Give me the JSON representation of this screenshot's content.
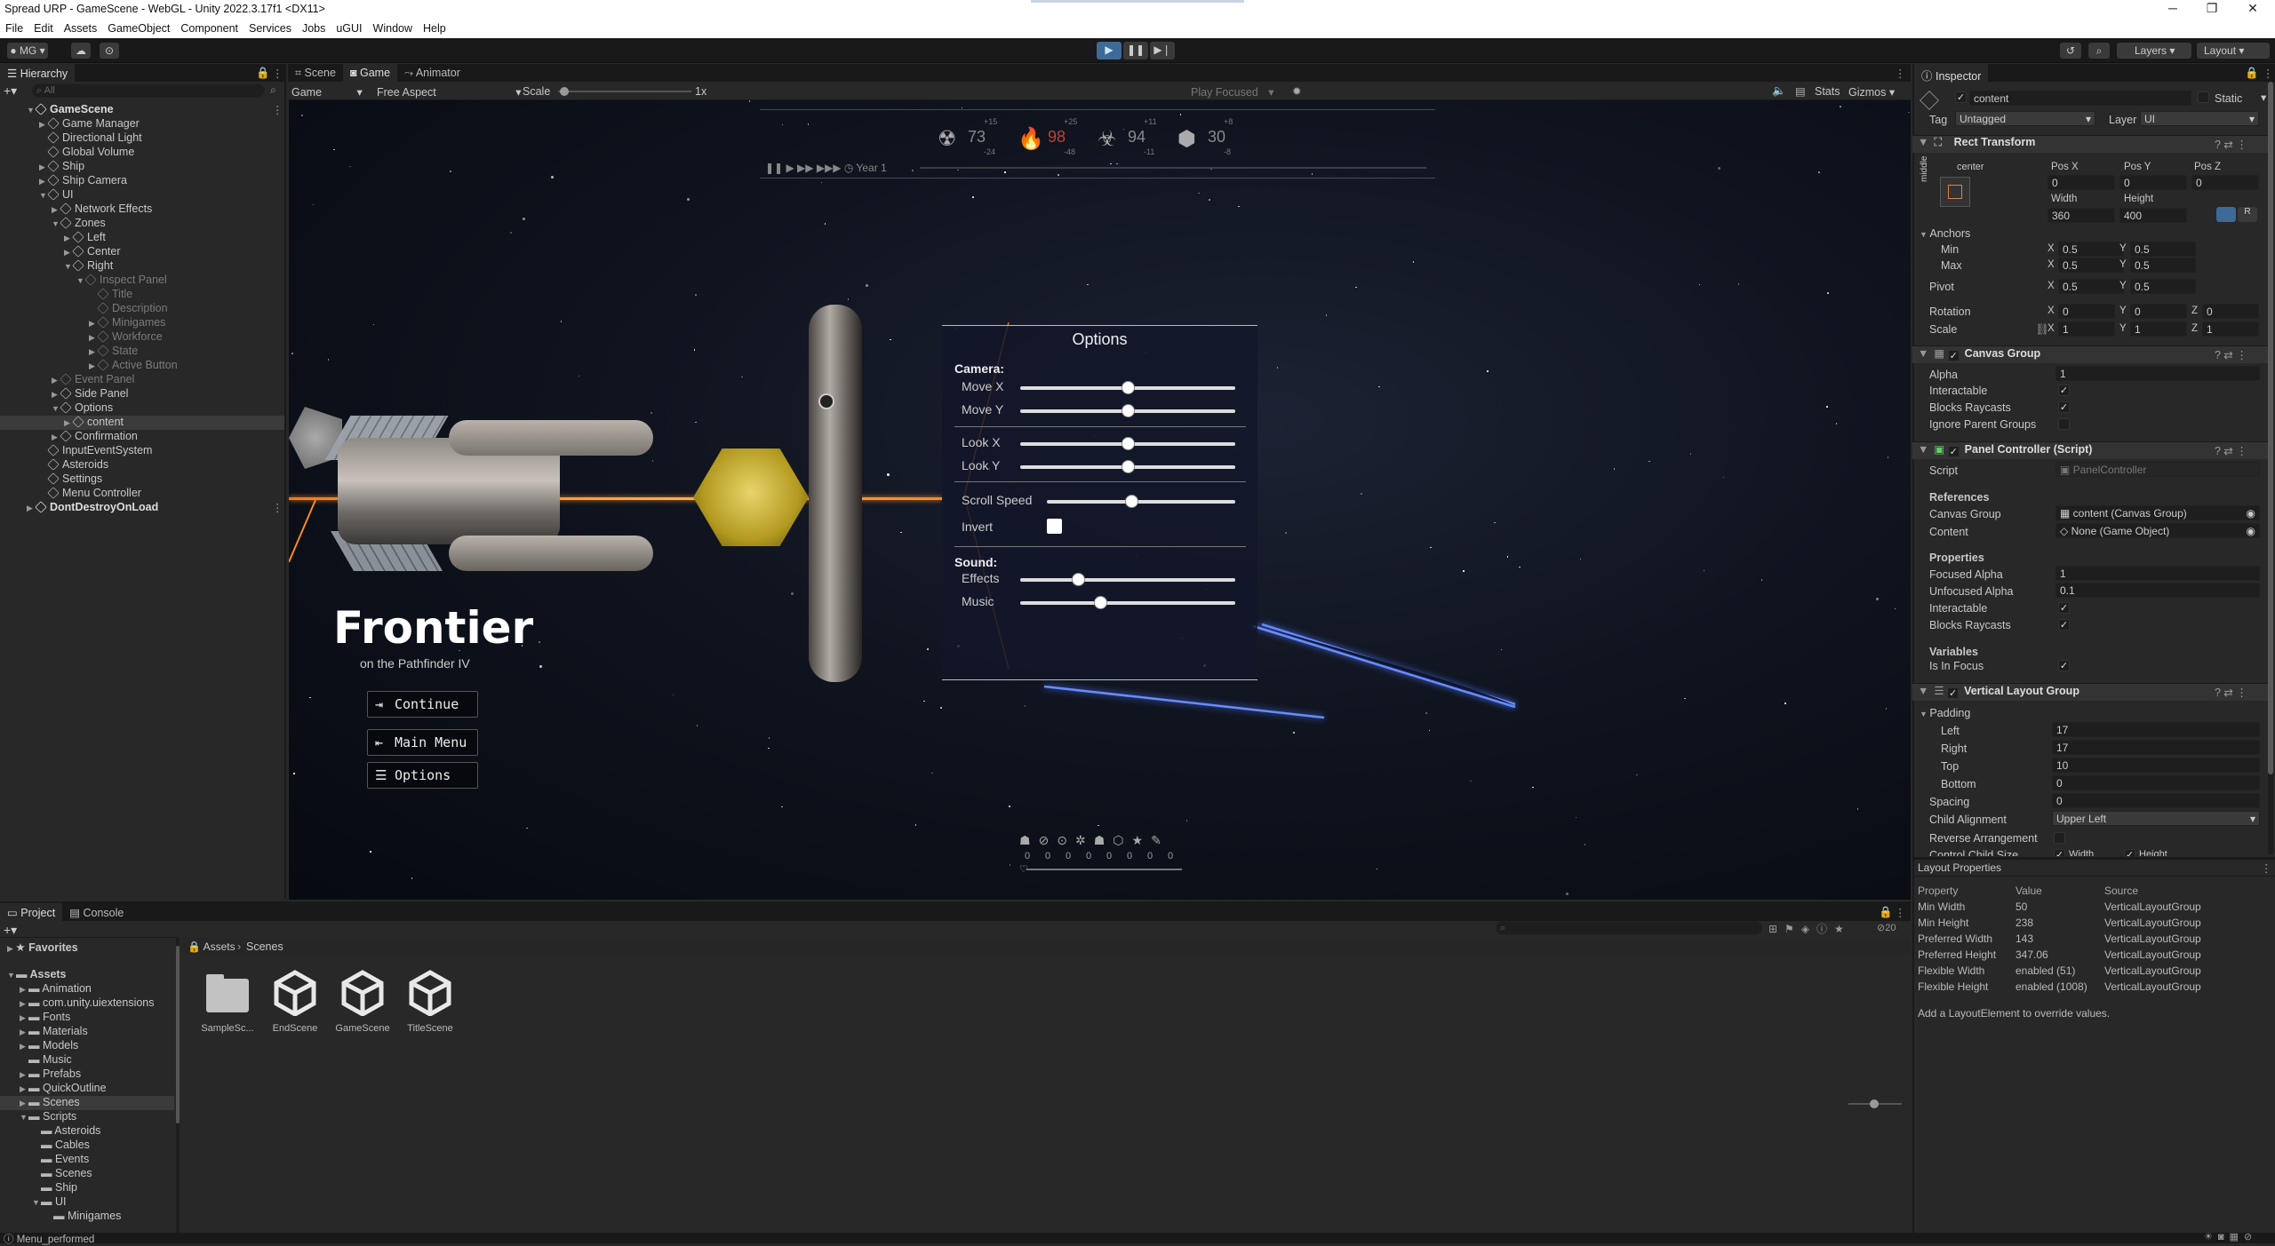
{
  "window": {
    "title": "Spread URP - GameScene - WebGL - Unity 2022.3.17f1 <DX11>",
    "controls": [
      "─",
      "❐",
      "✕"
    ]
  },
  "menu": [
    "File",
    "Edit",
    "Assets",
    "GameObject",
    "Component",
    "Services",
    "Jobs",
    "uGUI",
    "Window",
    "Help"
  ],
  "toolbar": {
    "account": "MG",
    "layers": "Layers",
    "layout": "Layout"
  },
  "hierarchy": {
    "tab": "Hierarchy",
    "search_placeholder": "All",
    "items": [
      {
        "label": "GameScene",
        "depth": 0,
        "arrow": "▼",
        "dim": false
      },
      {
        "label": "Game Manager",
        "depth": 1,
        "arrow": "▶",
        "dim": false
      },
      {
        "label": "Directional Light",
        "depth": 1,
        "arrow": "",
        "dim": false
      },
      {
        "label": "Global Volume",
        "depth": 1,
        "arrow": "",
        "dim": false
      },
      {
        "label": "Ship",
        "depth": 1,
        "arrow": "▶",
        "dim": false
      },
      {
        "label": "Ship Camera",
        "depth": 1,
        "arrow": "▶",
        "dim": false
      },
      {
        "label": "UI",
        "depth": 1,
        "arrow": "▼",
        "dim": false
      },
      {
        "label": "Network Effects",
        "depth": 2,
        "arrow": "▶",
        "dim": false
      },
      {
        "label": "Zones",
        "depth": 2,
        "arrow": "▼",
        "dim": false
      },
      {
        "label": "Left",
        "depth": 3,
        "arrow": "▶",
        "dim": false
      },
      {
        "label": "Center",
        "depth": 3,
        "arrow": "▶",
        "dim": false
      },
      {
        "label": "Right",
        "depth": 3,
        "arrow": "▼",
        "dim": false
      },
      {
        "label": "Inspect Panel",
        "depth": 4,
        "arrow": "▼",
        "dim": true
      },
      {
        "label": "Title",
        "depth": 5,
        "arrow": "",
        "dim": true
      },
      {
        "label": "Description",
        "depth": 5,
        "arrow": "",
        "dim": true
      },
      {
        "label": "Minigames",
        "depth": 5,
        "arrow": "▶",
        "dim": true
      },
      {
        "label": "Workforce",
        "depth": 5,
        "arrow": "▶",
        "dim": true
      },
      {
        "label": "State",
        "depth": 5,
        "arrow": "▶",
        "dim": true
      },
      {
        "label": "Active Button",
        "depth": 5,
        "arrow": "▶",
        "dim": true
      },
      {
        "label": "Event Panel",
        "depth": 2,
        "arrow": "▶",
        "dim": true
      },
      {
        "label": "Side Panel",
        "depth": 2,
        "arrow": "▶",
        "dim": false
      },
      {
        "label": "Options",
        "depth": 2,
        "arrow": "▼",
        "dim": false
      },
      {
        "label": "content",
        "depth": 3,
        "arrow": "▶",
        "dim": false,
        "selected": true
      },
      {
        "label": "Confirmation",
        "depth": 2,
        "arrow": "▶",
        "dim": false
      },
      {
        "label": "InputEventSystem",
        "depth": 1,
        "arrow": "",
        "dim": false
      },
      {
        "label": "Asteroids",
        "depth": 1,
        "arrow": "",
        "dim": false
      },
      {
        "label": "Settings",
        "depth": 1,
        "arrow": "",
        "dim": false
      },
      {
        "label": "Menu Controller",
        "depth": 1,
        "arrow": "",
        "dim": false
      },
      {
        "label": "DontDestroyOnLoad",
        "depth": 0,
        "arrow": "▶",
        "dim": false
      }
    ]
  },
  "center_tabs": [
    "Scene",
    "Game",
    "Animator"
  ],
  "game_bar": {
    "display": "Game",
    "aspect": "Free Aspect",
    "scale_label": "Scale",
    "scale_value": "1x",
    "play_focused": "Play Focused",
    "stats": "Stats",
    "gizmos": "Gizmos"
  },
  "hud": {
    "counters": [
      "73",
      "98",
      "94",
      "30"
    ],
    "deltas_top": [
      "+15",
      "+25",
      "+11",
      "+8"
    ],
    "deltas_bottom": [
      "-24",
      "-48",
      "-11",
      "-8"
    ],
    "timer_label": "Year 1"
  },
  "game_ui": {
    "title": "Frontier",
    "subtitle": "on the Pathfinder IV",
    "buttons": [
      "Continue",
      "Main Menu",
      "Options"
    ]
  },
  "options_panel": {
    "title": "Options",
    "camera_heading": "Camera:",
    "sound_heading": "Sound:",
    "sliders": [
      {
        "label": "Move X",
        "value": 0.5
      },
      {
        "label": "Move Y",
        "value": 0.5
      },
      {
        "label": "Look X",
        "value": 0.5
      },
      {
        "label": "Look Y",
        "value": 0.5
      },
      {
        "label": "Scroll Speed",
        "value": 0.45
      },
      {
        "label": "Effects",
        "value": 0.27
      },
      {
        "label": "Music",
        "value": 0.37
      }
    ],
    "invert_label": "Invert"
  },
  "bottom_hud": {
    "values": [
      "0",
      "0",
      "0",
      "0",
      "0",
      "0",
      "0",
      "0"
    ]
  },
  "inspector": {
    "tab": "Inspector",
    "object_name": "content",
    "static_label": "Static",
    "tag_label": "Tag",
    "tag_value": "Untagged",
    "layer_label": "Layer",
    "layer_value": "UI",
    "rect_transform": {
      "title": "Rect Transform",
      "anchor_preset": "center",
      "anchor_side": "middle",
      "pos_x_label": "Pos X",
      "pos_y_label": "Pos Y",
      "pos_z_label": "Pos Z",
      "pos_x": "0",
      "pos_y": "0",
      "pos_z": "0",
      "width_label": "Width",
      "height_label": "Height",
      "width": "360",
      "height": "400",
      "anchors": "Anchors",
      "min": "Min",
      "max": "Max",
      "pivot": "Pivot",
      "x": "X",
      "y": "Y",
      "z": "Z",
      "min_x": "0.5",
      "min_y": "0.5",
      "max_x": "0.5",
      "max_y": "0.5",
      "pivot_x": "0.5",
      "pivot_y": "0.5",
      "rotation": "Rotation",
      "rot_x": "0",
      "rot_y": "0",
      "rot_z": "0",
      "scale": "Scale",
      "scale_x": "1",
      "scale_y": "1",
      "scale_z": "1"
    },
    "canvas_group": {
      "title": "Canvas Group",
      "alpha_label": "Alpha",
      "alpha": "1",
      "interactable": "Interactable",
      "blocks": "Blocks Raycasts",
      "ignore": "Ignore Parent Groups"
    },
    "panel_controller": {
      "title": "Panel Controller (Script)",
      "script_label": "Script",
      "script_value": "PanelController",
      "references": "References",
      "canvas_group_label": "Canvas Group",
      "canvas_group_value": "content (Canvas Group)",
      "content_label": "Content",
      "content_value": "None (Game Object)",
      "properties": "Properties",
      "focused_alpha_label": "Focused Alpha",
      "focused_alpha": "1",
      "unfocused_alpha_label": "Unfocused Alpha",
      "unfocused_alpha": "0.1",
      "interactable": "Interactable",
      "blocks": "Blocks Raycasts",
      "variables": "Variables",
      "in_focus": "Is In Focus"
    },
    "vlg": {
      "title": "Vertical Layout Group",
      "padding": "Padding",
      "left_label": "Left",
      "left": "17",
      "right_label": "Right",
      "right": "17",
      "top_label": "Top",
      "top": "10",
      "bottom_label": "Bottom",
      "bottom": "0",
      "spacing_label": "Spacing",
      "spacing": "0",
      "child_alignment_label": "Child Alignment",
      "child_alignment": "Upper Left",
      "reverse": "Reverse Arrangement",
      "control": "Control Child Size",
      "width": "Width",
      "height": "Height"
    }
  },
  "layout_properties": {
    "title": "Layout Properties",
    "headers": [
      "Property",
      "Value",
      "Source"
    ],
    "rows": [
      [
        "Min Width",
        "50",
        "VerticalLayoutGroup"
      ],
      [
        "Min Height",
        "238",
        "VerticalLayoutGroup"
      ],
      [
        "Preferred Width",
        "143",
        "VerticalLayoutGroup"
      ],
      [
        "Preferred Height",
        "347.06",
        "VerticalLayoutGroup"
      ],
      [
        "Flexible Width",
        "enabled (51)",
        "VerticalLayoutGroup"
      ],
      [
        "Flexible Height",
        "enabled (1008)",
        "VerticalLayoutGroup"
      ]
    ],
    "hint": "Add a LayoutElement to override values."
  },
  "project": {
    "tabs": [
      "Project",
      "Console"
    ],
    "favorites": "Favorites",
    "breadcrumb": [
      "Assets",
      "Scenes"
    ],
    "tree": [
      {
        "label": "Assets",
        "depth": 0,
        "arrow": "▼",
        "bold": true
      },
      {
        "label": "Animation",
        "depth": 1,
        "arrow": "▶"
      },
      {
        "label": "com.unity.uiextensions",
        "depth": 1,
        "arrow": "▶"
      },
      {
        "label": "Fonts",
        "depth": 1,
        "arrow": "▶"
      },
      {
        "label": "Materials",
        "depth": 1,
        "arrow": "▶"
      },
      {
        "label": "Models",
        "depth": 1,
        "arrow": "▶"
      },
      {
        "label": "Music",
        "depth": 1,
        "arrow": ""
      },
      {
        "label": "Prefabs",
        "depth": 1,
        "arrow": "▶"
      },
      {
        "label": "QuickOutline",
        "depth": 1,
        "arrow": "▶"
      },
      {
        "label": "Scenes",
        "depth": 1,
        "arrow": "▶",
        "selected": true
      },
      {
        "label": "Scripts",
        "depth": 1,
        "arrow": "▼"
      },
      {
        "label": "Asteroids",
        "depth": 2,
        "arrow": ""
      },
      {
        "label": "Cables",
        "depth": 2,
        "arrow": ""
      },
      {
        "label": "Events",
        "depth": 2,
        "arrow": ""
      },
      {
        "label": "Scenes",
        "depth": 2,
        "arrow": ""
      },
      {
        "label": "Ship",
        "depth": 2,
        "arrow": ""
      },
      {
        "label": "UI",
        "depth": 2,
        "arrow": "▼"
      },
      {
        "label": "Minigames",
        "depth": 3,
        "arrow": ""
      }
    ],
    "assets": [
      {
        "label": "SampleSc...",
        "kind": "folder"
      },
      {
        "label": "EndScene",
        "kind": "scene"
      },
      {
        "label": "GameScene",
        "kind": "scene"
      },
      {
        "label": "TitleScene",
        "kind": "scene"
      }
    ],
    "count": "20"
  },
  "status": {
    "message": "Menu_performed"
  },
  "colors": {
    "accent": "#4a8fd8",
    "selection": "#2c5d87",
    "panel": "#282828",
    "header": "#191919",
    "laser_orange": "#ff8a1e",
    "laser_blue": "#4a78ff"
  }
}
